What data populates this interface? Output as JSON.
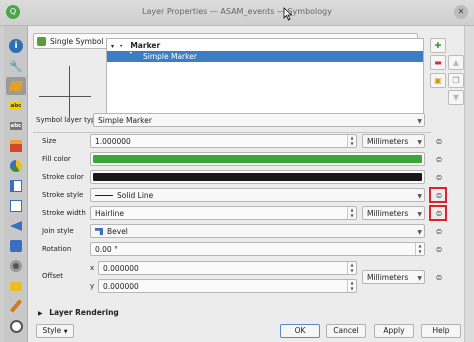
{
  "window": {
    "title": "Layer Properties — ASAM_events — Symbology"
  },
  "renderer": {
    "selected": "Single Symbol"
  },
  "symbol_tree": {
    "root": "Marker",
    "child": "Simple Marker"
  },
  "symbol_layer_type": {
    "label": "Symbol layer type",
    "value": "Simple Marker"
  },
  "properties": {
    "size": {
      "label": "Size",
      "value": "1.000000",
      "unit": "Millimeters"
    },
    "fill_color": {
      "label": "Fill color",
      "color": "#3aa53a"
    },
    "stroke_color": {
      "label": "Stroke color",
      "color": "#181818"
    },
    "stroke_style": {
      "label": "Stroke style",
      "value": "Solid Line"
    },
    "stroke_width": {
      "label": "Stroke width",
      "value": "Hairline",
      "unit": "Millimeters"
    },
    "join_style": {
      "label": "Join style",
      "value": "Bevel"
    },
    "rotation": {
      "label": "Rotation",
      "value": "0.00 °"
    },
    "offset": {
      "label": "Offset",
      "x_label": "x",
      "x_value": "0.000000",
      "y_label": "y",
      "y_value": "0.000000",
      "unit": "Millimeters"
    }
  },
  "footer": {
    "layer_rendering": "Layer Rendering",
    "style": "Style",
    "ok": "OK",
    "cancel": "Cancel",
    "apply": "Apply",
    "help": "Help"
  },
  "sidebar_labels": {
    "labels": "abc",
    "labels2": "abc"
  }
}
